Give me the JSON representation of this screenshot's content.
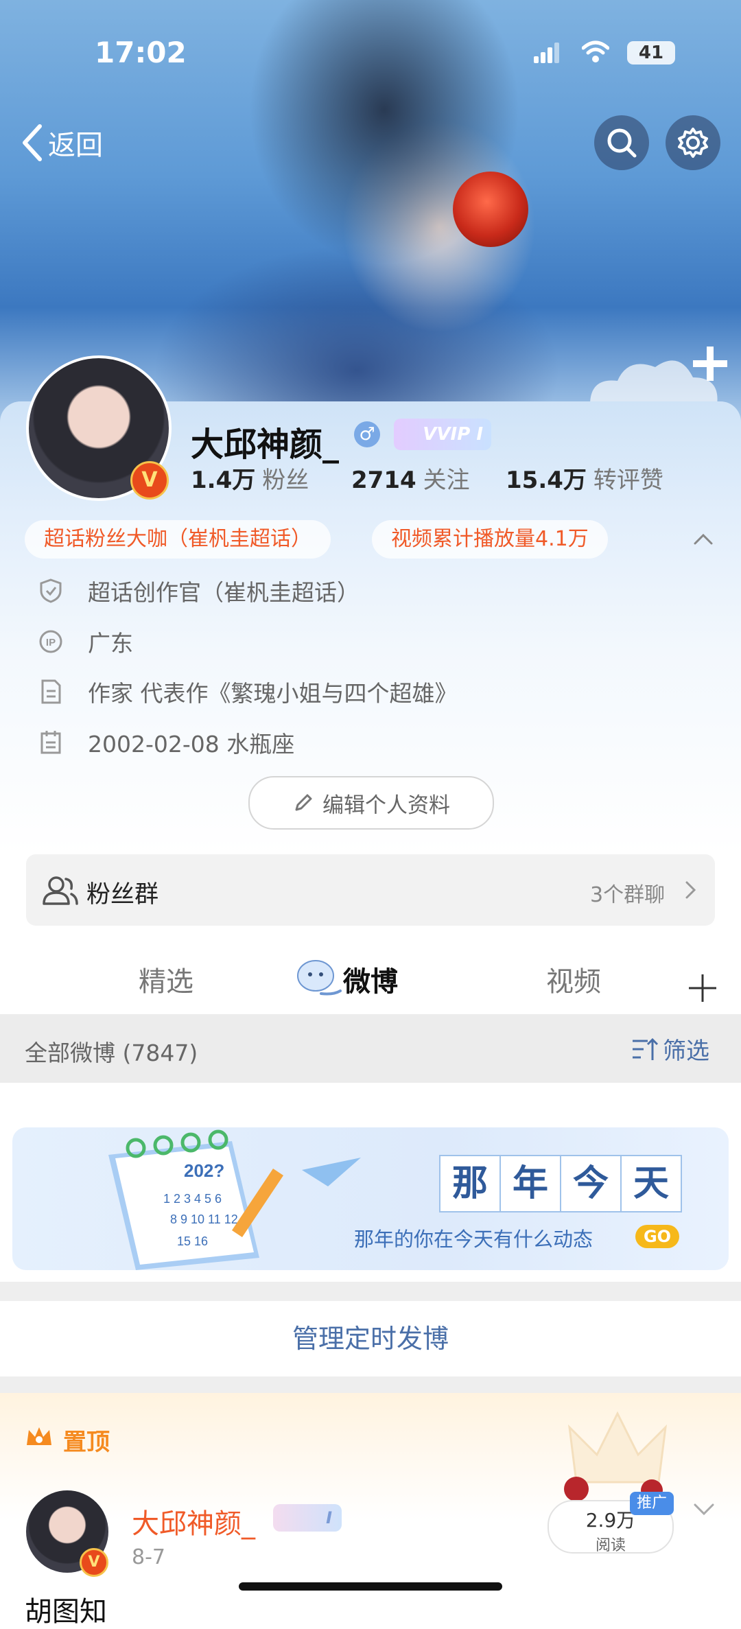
{
  "status_bar": {
    "time": "17:02",
    "battery": "41"
  },
  "nav": {
    "back_label": "返回"
  },
  "profile": {
    "name": "大邱神颜_",
    "vip_badge": "VVIP I",
    "stats": [
      {
        "value": "1.4万",
        "label": "粉丝"
      },
      {
        "value": "2714",
        "label": "关注"
      },
      {
        "value": "15.4万",
        "label": "转评赞"
      }
    ],
    "tags": [
      "超话粉丝大咖（崔杋圭超话）",
      "视频累计播放量4.1万"
    ],
    "info": [
      {
        "icon": "shield-icon",
        "text": "超话创作官（崔杋圭超话）"
      },
      {
        "icon": "ip-icon",
        "text": "广东"
      },
      {
        "icon": "document-icon",
        "text": "作家 代表作《繁瑰小姐与四个超雄》"
      },
      {
        "icon": "calendar-icon",
        "text": "2002-02-08 水瓶座"
      }
    ],
    "edit_label": "编辑个人资料"
  },
  "fans_group": {
    "label": "粉丝群",
    "count": "3个群聊"
  },
  "tabs": [
    "精选",
    "微博",
    "视频"
  ],
  "feed": {
    "all_label": "全部微博 (7847)",
    "filter_label": "筛选",
    "banner": {
      "year": "202?",
      "title_chars": [
        "那",
        "年",
        "今",
        "天"
      ],
      "subtitle": "那年的你在今天有什么动态",
      "go": "GO"
    },
    "manage_label": "管理定时发博",
    "pinned_label": "置顶",
    "post": {
      "author": "大邱神颜_",
      "author_badge": "I",
      "date": "8-7",
      "reads_value": "2.9万",
      "reads_label": "阅读",
      "promo": "推广",
      "text_start": "胡图知"
    }
  },
  "colors": {
    "accent_orange": "#f05a28",
    "link_blue": "#4a6fa8",
    "dark": "#111111"
  }
}
